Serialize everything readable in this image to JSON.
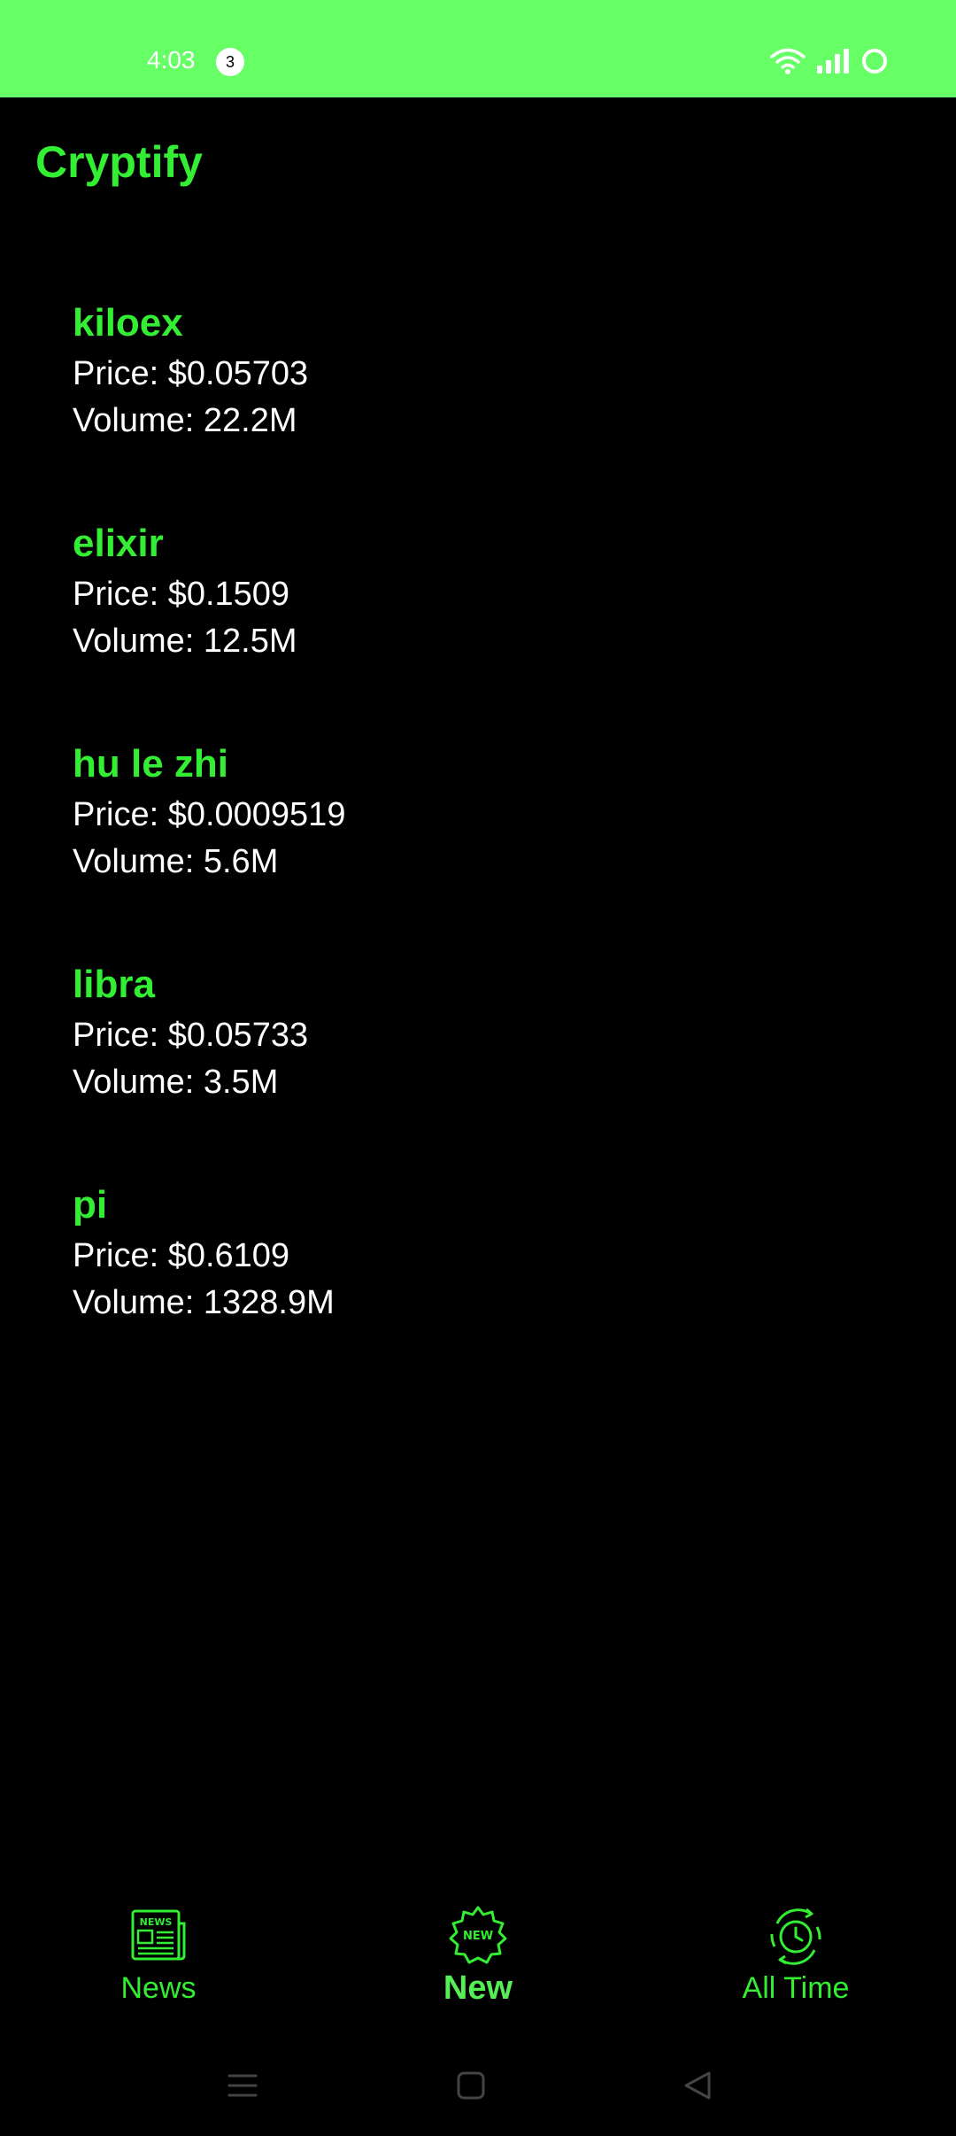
{
  "status_bar": {
    "time": "4:03",
    "notification_count": "3",
    "icons": [
      "wifi-icon",
      "signal-icon",
      "battery-icon"
    ],
    "background": "#66ff66"
  },
  "app": {
    "title": "Cryptify",
    "accent_color": "#33ee33"
  },
  "coins": [
    {
      "name": "kiloex",
      "price": "Price: $0.05703",
      "volume": "Volume: 22.2M"
    },
    {
      "name": "elixir",
      "price": "Price: $0.1509",
      "volume": "Volume: 12.5M"
    },
    {
      "name": "hu le zhi",
      "price": "Price: $0.0009519",
      "volume": "Volume: 5.6M"
    },
    {
      "name": "libra",
      "price": "Price: $0.05733",
      "volume": "Volume: 3.5M"
    },
    {
      "name": "pi",
      "price": "Price: $0.6109",
      "volume": "Volume: 1328.9M"
    }
  ],
  "bottom_nav": {
    "selected": "New",
    "items": [
      {
        "label": "News",
        "icon": "newspaper-icon"
      },
      {
        "label": "New",
        "icon": "new-badge-icon"
      },
      {
        "label": "All Time",
        "icon": "clock-history-icon"
      }
    ]
  },
  "system_nav": {
    "icons": [
      "menu-icon",
      "home-icon",
      "back-icon"
    ]
  }
}
